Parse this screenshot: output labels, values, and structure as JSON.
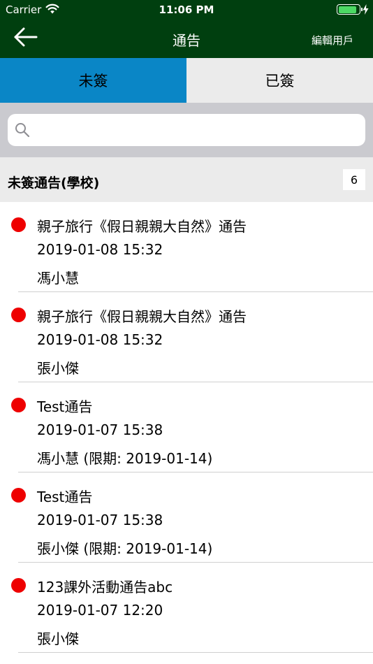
{
  "status_bar": {
    "carrier": "Carrier",
    "time": "11:06 PM"
  },
  "nav": {
    "title": "通告",
    "edit_user": "編輯用戶"
  },
  "tabs": [
    {
      "label": "未簽",
      "active": true
    },
    {
      "label": "已簽",
      "active": false
    }
  ],
  "search": {
    "placeholder": ""
  },
  "section": {
    "title": "未簽通告(學校)",
    "count": "6"
  },
  "notices": [
    {
      "title": "親子旅行《假日親親大自然》通告",
      "datetime": "2019-01-08 15:32",
      "author": "馮小慧"
    },
    {
      "title": "親子旅行《假日親親大自然》通告",
      "datetime": "2019-01-08 15:32",
      "author": "張小傑"
    },
    {
      "title": "Test通告",
      "datetime": "2019-01-07 15:38",
      "author": "馮小慧 (限期: 2019-01-14)"
    },
    {
      "title": "Test通告",
      "datetime": "2019-01-07 15:38",
      "author": "張小傑 (限期: 2019-01-14)"
    },
    {
      "title": "123課外活動通告abc",
      "datetime": "2019-01-07 12:20",
      "author": "張小傑"
    }
  ],
  "colors": {
    "nav_background": "#003f0f",
    "active_tab": "#0a86c6",
    "unread_dot": "#ee0000"
  }
}
